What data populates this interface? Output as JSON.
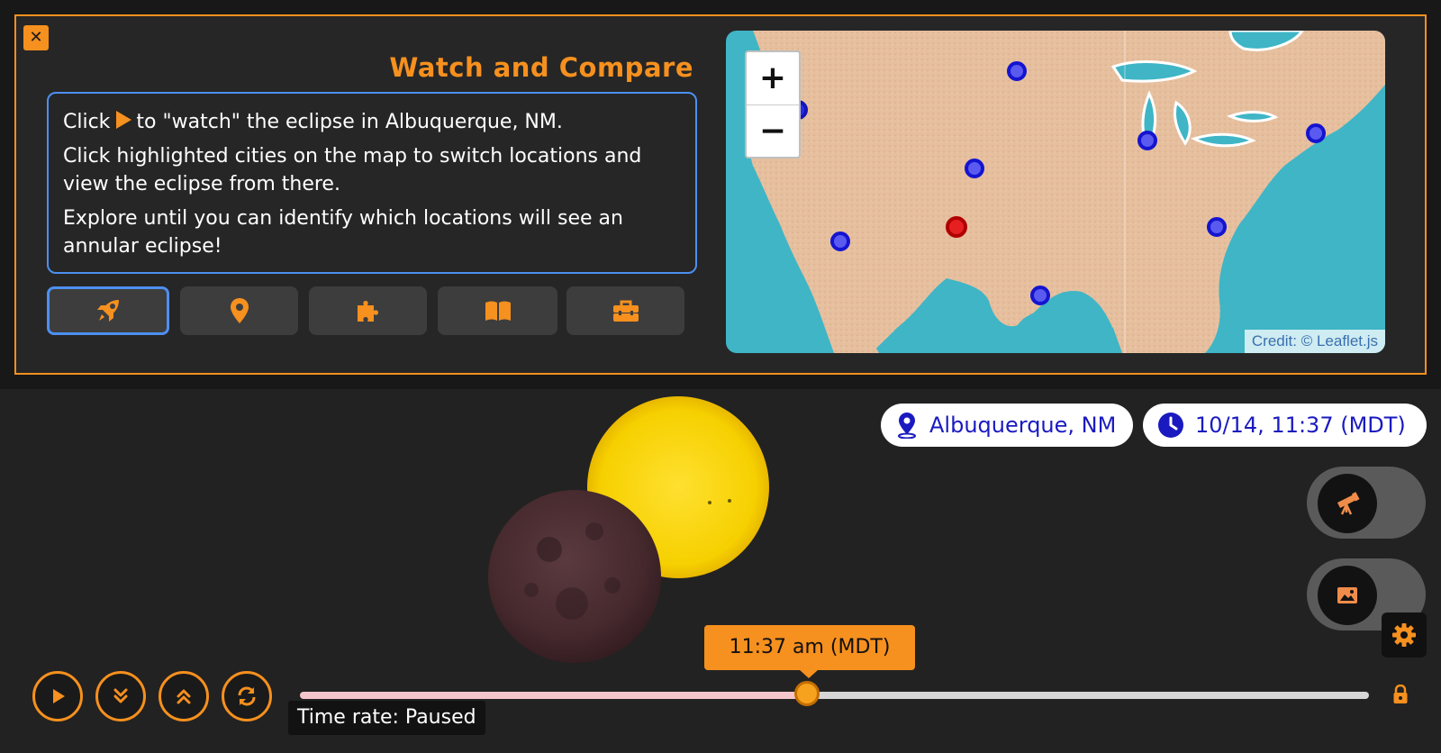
{
  "panel": {
    "close_label": "✕",
    "title": "Watch and Compare",
    "instructions": {
      "line1_pre": "Click",
      "line1_post": "to \"watch\" the eclipse in Albuquerque, NM.",
      "line2": "Click highlighted cities on the map to switch locations and view the eclipse from there.",
      "line3": "Explore until you can identify which locations will see an annular eclipse!"
    },
    "tabs": [
      {
        "icon": "rocket-icon",
        "active": true
      },
      {
        "icon": "map-marker-icon",
        "active": false
      },
      {
        "icon": "puzzle-piece-icon",
        "active": false
      },
      {
        "icon": "book-icon",
        "active": false
      },
      {
        "icon": "toolbox-icon",
        "active": false
      }
    ]
  },
  "map": {
    "zoom_in": "+",
    "zoom_out": "−",
    "credit": "Credit: © Leaflet.js",
    "selected_city": "Albuquerque, NM",
    "colors": {
      "water": "#3fb8c8",
      "land": "#e8c2a0",
      "city_marker": "#1a1adc",
      "selected_marker": "#e01010"
    }
  },
  "info": {
    "location": "Albuquerque, NM",
    "datetime": "10/14, 11:37 (MDT)"
  },
  "toggles": [
    {
      "icon": "telescope-icon"
    },
    {
      "icon": "image-icon"
    }
  ],
  "controls": {
    "buttons": [
      {
        "name": "play-button",
        "icon": "play-icon"
      },
      {
        "name": "slow-down-button",
        "icon": "chevrons-down-icon"
      },
      {
        "name": "speed-up-button",
        "icon": "chevrons-up-icon"
      },
      {
        "name": "reset-button",
        "icon": "sync-icon"
      }
    ],
    "slider": {
      "progress": 0.48
    },
    "time_tooltip": "11:37 am (MDT)",
    "time_rate": "Time rate: Paused"
  },
  "colors": {
    "accent": "#f6901e",
    "panel_border": "#f6901e",
    "focus_blue": "#4d8ff0",
    "pill_text": "#1a1ac0"
  }
}
